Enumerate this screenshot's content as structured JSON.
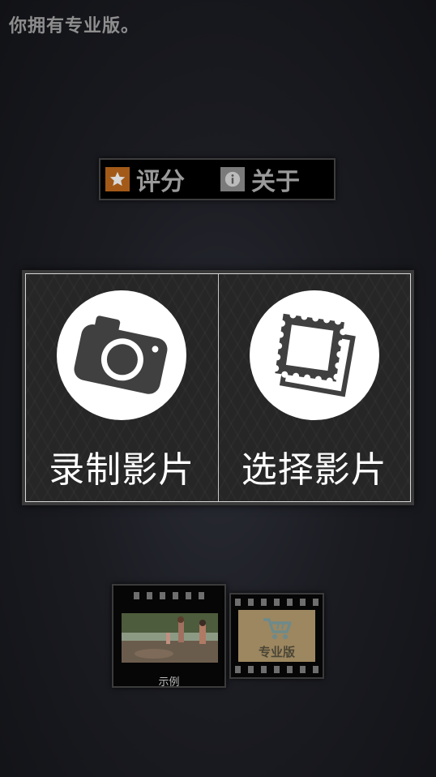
{
  "status_text": "你拥有专业版。",
  "action_bar": {
    "rate_label": "评分",
    "rate_icon": "star-icon",
    "about_label": "关于",
    "about_icon": "info-icon"
  },
  "main": {
    "record_label": "录制影片",
    "record_icon": "camera-icon",
    "choose_label": "选择影片",
    "choose_icon": "photo-stamp-icon"
  },
  "thumbnails": {
    "sample_caption": "示例",
    "pro_caption": "专业版",
    "pro_icon": "cart-icon"
  },
  "colors": {
    "background": "#1b1c22",
    "star_box": "#a35a18",
    "pro_box": "#9d8760"
  }
}
